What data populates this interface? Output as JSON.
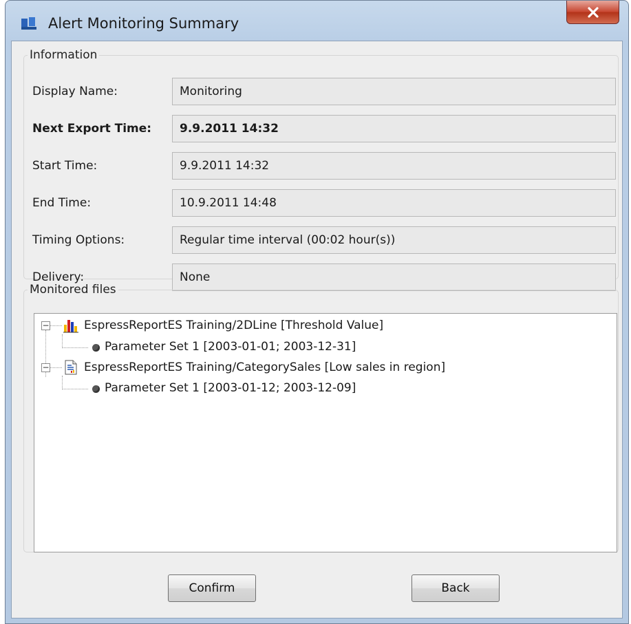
{
  "window": {
    "title": "Alert Monitoring Summary"
  },
  "info": {
    "legend": "Information",
    "rows": [
      {
        "label": "Display Name:",
        "value": "Monitoring"
      },
      {
        "label": "Next Export Time:",
        "value": "9.9.2011 14:32"
      },
      {
        "label": "Start Time:",
        "value": "9.9.2011 14:32"
      },
      {
        "label": "End Time:",
        "value": "10.9.2011 14:48"
      },
      {
        "label": "Timing Options:",
        "value": "Regular time interval (00:02 hour(s))"
      },
      {
        "label": "Delivery:",
        "value": "None"
      }
    ]
  },
  "files": {
    "legend": "Monitored files",
    "nodes": [
      {
        "label": "EspressReportES Training/2DLine [Threshold Value]",
        "icon": "bar-chart-icon",
        "children": [
          {
            "label": "Parameter Set 1 [2003-01-01; 2003-12-31]"
          }
        ]
      },
      {
        "label": "EspressReportES Training/CategorySales [Low sales in region]",
        "icon": "report-document-icon",
        "children": [
          {
            "label": "Parameter Set 1 [2003-01-12; 2003-12-09]"
          }
        ]
      }
    ]
  },
  "buttons": {
    "confirm": "Confirm",
    "back": "Back"
  }
}
